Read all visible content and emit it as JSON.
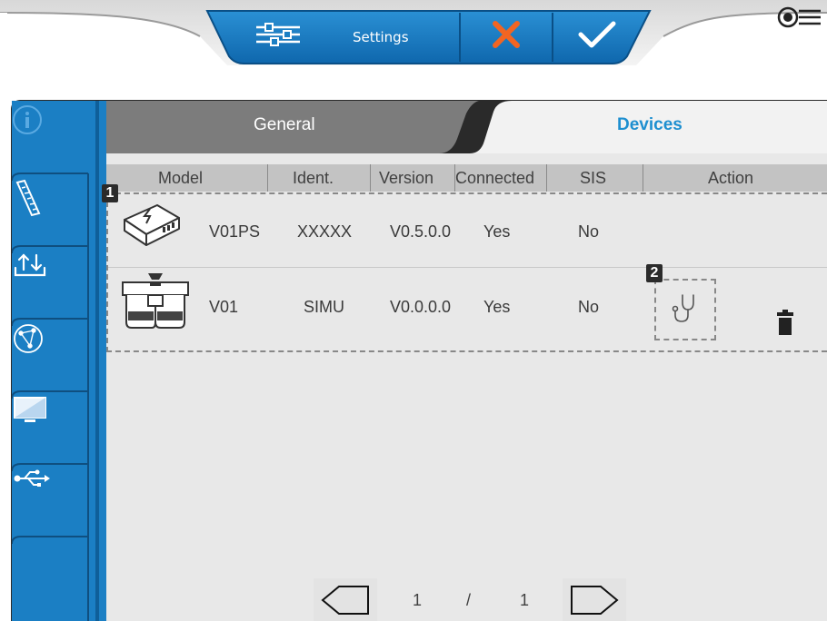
{
  "toolbar": {
    "title": "Settings",
    "icons": [
      "sliders-icon",
      "close-icon",
      "check-icon",
      "menu-icon"
    ],
    "colors": {
      "blue": "#1b7fc4",
      "cancel": "#f26522",
      "confirm": "#ffffff"
    }
  },
  "sidebar": {
    "items": [
      {
        "icon": "info-icon"
      },
      {
        "icon": "ruler-icon"
      },
      {
        "icon": "upload-download-icon"
      },
      {
        "icon": "network-globe-icon"
      },
      {
        "icon": "monitor-icon"
      },
      {
        "icon": "usb-icon"
      },
      {
        "icon": "empty-tab"
      }
    ],
    "accent": "#1b7fc4"
  },
  "tabs": {
    "general": "General",
    "devices": "Devices",
    "active": "Devices"
  },
  "table": {
    "columns": [
      "Model",
      "Ident.",
      "Version",
      "Connected",
      "SIS",
      "Action"
    ],
    "rows": [
      {
        "icon": "power-supply-icon",
        "model": "V01PS",
        "ident": "XXXXX",
        "version": "V0.5.0.0",
        "connected": "Yes",
        "sis": "No",
        "actions": []
      },
      {
        "icon": "foot-pedal-icon",
        "model": "V01",
        "ident": "SIMU",
        "version": "V0.0.0.0",
        "connected": "Yes",
        "sis": "No",
        "actions": [
          "stethoscope-icon",
          "trash-icon"
        ]
      }
    ]
  },
  "markers": {
    "list": "1",
    "action": "2"
  },
  "pager": {
    "current": "1",
    "separator": "/",
    "total": "1"
  }
}
